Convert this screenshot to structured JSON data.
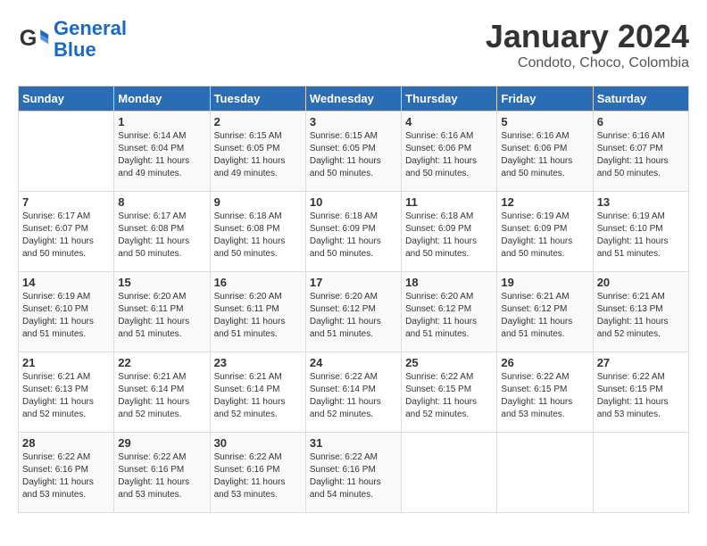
{
  "logo": {
    "text_general": "General",
    "text_blue": "Blue"
  },
  "header": {
    "month": "January 2024",
    "location": "Condoto, Choco, Colombia"
  },
  "days_of_week": [
    "Sunday",
    "Monday",
    "Tuesday",
    "Wednesday",
    "Thursday",
    "Friday",
    "Saturday"
  ],
  "weeks": [
    [
      {
        "day": "",
        "info": ""
      },
      {
        "day": "1",
        "info": "Sunrise: 6:14 AM\nSunset: 6:04 PM\nDaylight: 11 hours\nand 49 minutes."
      },
      {
        "day": "2",
        "info": "Sunrise: 6:15 AM\nSunset: 6:05 PM\nDaylight: 11 hours\nand 49 minutes."
      },
      {
        "day": "3",
        "info": "Sunrise: 6:15 AM\nSunset: 6:05 PM\nDaylight: 11 hours\nand 50 minutes."
      },
      {
        "day": "4",
        "info": "Sunrise: 6:16 AM\nSunset: 6:06 PM\nDaylight: 11 hours\nand 50 minutes."
      },
      {
        "day": "5",
        "info": "Sunrise: 6:16 AM\nSunset: 6:06 PM\nDaylight: 11 hours\nand 50 minutes."
      },
      {
        "day": "6",
        "info": "Sunrise: 6:16 AM\nSunset: 6:07 PM\nDaylight: 11 hours\nand 50 minutes."
      }
    ],
    [
      {
        "day": "7",
        "info": "Sunrise: 6:17 AM\nSunset: 6:07 PM\nDaylight: 11 hours\nand 50 minutes."
      },
      {
        "day": "8",
        "info": "Sunrise: 6:17 AM\nSunset: 6:08 PM\nDaylight: 11 hours\nand 50 minutes."
      },
      {
        "day": "9",
        "info": "Sunrise: 6:18 AM\nSunset: 6:08 PM\nDaylight: 11 hours\nand 50 minutes."
      },
      {
        "day": "10",
        "info": "Sunrise: 6:18 AM\nSunset: 6:09 PM\nDaylight: 11 hours\nand 50 minutes."
      },
      {
        "day": "11",
        "info": "Sunrise: 6:18 AM\nSunset: 6:09 PM\nDaylight: 11 hours\nand 50 minutes."
      },
      {
        "day": "12",
        "info": "Sunrise: 6:19 AM\nSunset: 6:09 PM\nDaylight: 11 hours\nand 50 minutes."
      },
      {
        "day": "13",
        "info": "Sunrise: 6:19 AM\nSunset: 6:10 PM\nDaylight: 11 hours\nand 51 minutes."
      }
    ],
    [
      {
        "day": "14",
        "info": "Sunrise: 6:19 AM\nSunset: 6:10 PM\nDaylight: 11 hours\nand 51 minutes."
      },
      {
        "day": "15",
        "info": "Sunrise: 6:20 AM\nSunset: 6:11 PM\nDaylight: 11 hours\nand 51 minutes."
      },
      {
        "day": "16",
        "info": "Sunrise: 6:20 AM\nSunset: 6:11 PM\nDaylight: 11 hours\nand 51 minutes."
      },
      {
        "day": "17",
        "info": "Sunrise: 6:20 AM\nSunset: 6:12 PM\nDaylight: 11 hours\nand 51 minutes."
      },
      {
        "day": "18",
        "info": "Sunrise: 6:20 AM\nSunset: 6:12 PM\nDaylight: 11 hours\nand 51 minutes."
      },
      {
        "day": "19",
        "info": "Sunrise: 6:21 AM\nSunset: 6:12 PM\nDaylight: 11 hours\nand 51 minutes."
      },
      {
        "day": "20",
        "info": "Sunrise: 6:21 AM\nSunset: 6:13 PM\nDaylight: 11 hours\nand 52 minutes."
      }
    ],
    [
      {
        "day": "21",
        "info": "Sunrise: 6:21 AM\nSunset: 6:13 PM\nDaylight: 11 hours\nand 52 minutes."
      },
      {
        "day": "22",
        "info": "Sunrise: 6:21 AM\nSunset: 6:14 PM\nDaylight: 11 hours\nand 52 minutes."
      },
      {
        "day": "23",
        "info": "Sunrise: 6:21 AM\nSunset: 6:14 PM\nDaylight: 11 hours\nand 52 minutes."
      },
      {
        "day": "24",
        "info": "Sunrise: 6:22 AM\nSunset: 6:14 PM\nDaylight: 11 hours\nand 52 minutes."
      },
      {
        "day": "25",
        "info": "Sunrise: 6:22 AM\nSunset: 6:15 PM\nDaylight: 11 hours\nand 52 minutes."
      },
      {
        "day": "26",
        "info": "Sunrise: 6:22 AM\nSunset: 6:15 PM\nDaylight: 11 hours\nand 53 minutes."
      },
      {
        "day": "27",
        "info": "Sunrise: 6:22 AM\nSunset: 6:15 PM\nDaylight: 11 hours\nand 53 minutes."
      }
    ],
    [
      {
        "day": "28",
        "info": "Sunrise: 6:22 AM\nSunset: 6:16 PM\nDaylight: 11 hours\nand 53 minutes."
      },
      {
        "day": "29",
        "info": "Sunrise: 6:22 AM\nSunset: 6:16 PM\nDaylight: 11 hours\nand 53 minutes."
      },
      {
        "day": "30",
        "info": "Sunrise: 6:22 AM\nSunset: 6:16 PM\nDaylight: 11 hours\nand 53 minutes."
      },
      {
        "day": "31",
        "info": "Sunrise: 6:22 AM\nSunset: 6:16 PM\nDaylight: 11 hours\nand 54 minutes."
      },
      {
        "day": "",
        "info": ""
      },
      {
        "day": "",
        "info": ""
      },
      {
        "day": "",
        "info": ""
      }
    ]
  ]
}
